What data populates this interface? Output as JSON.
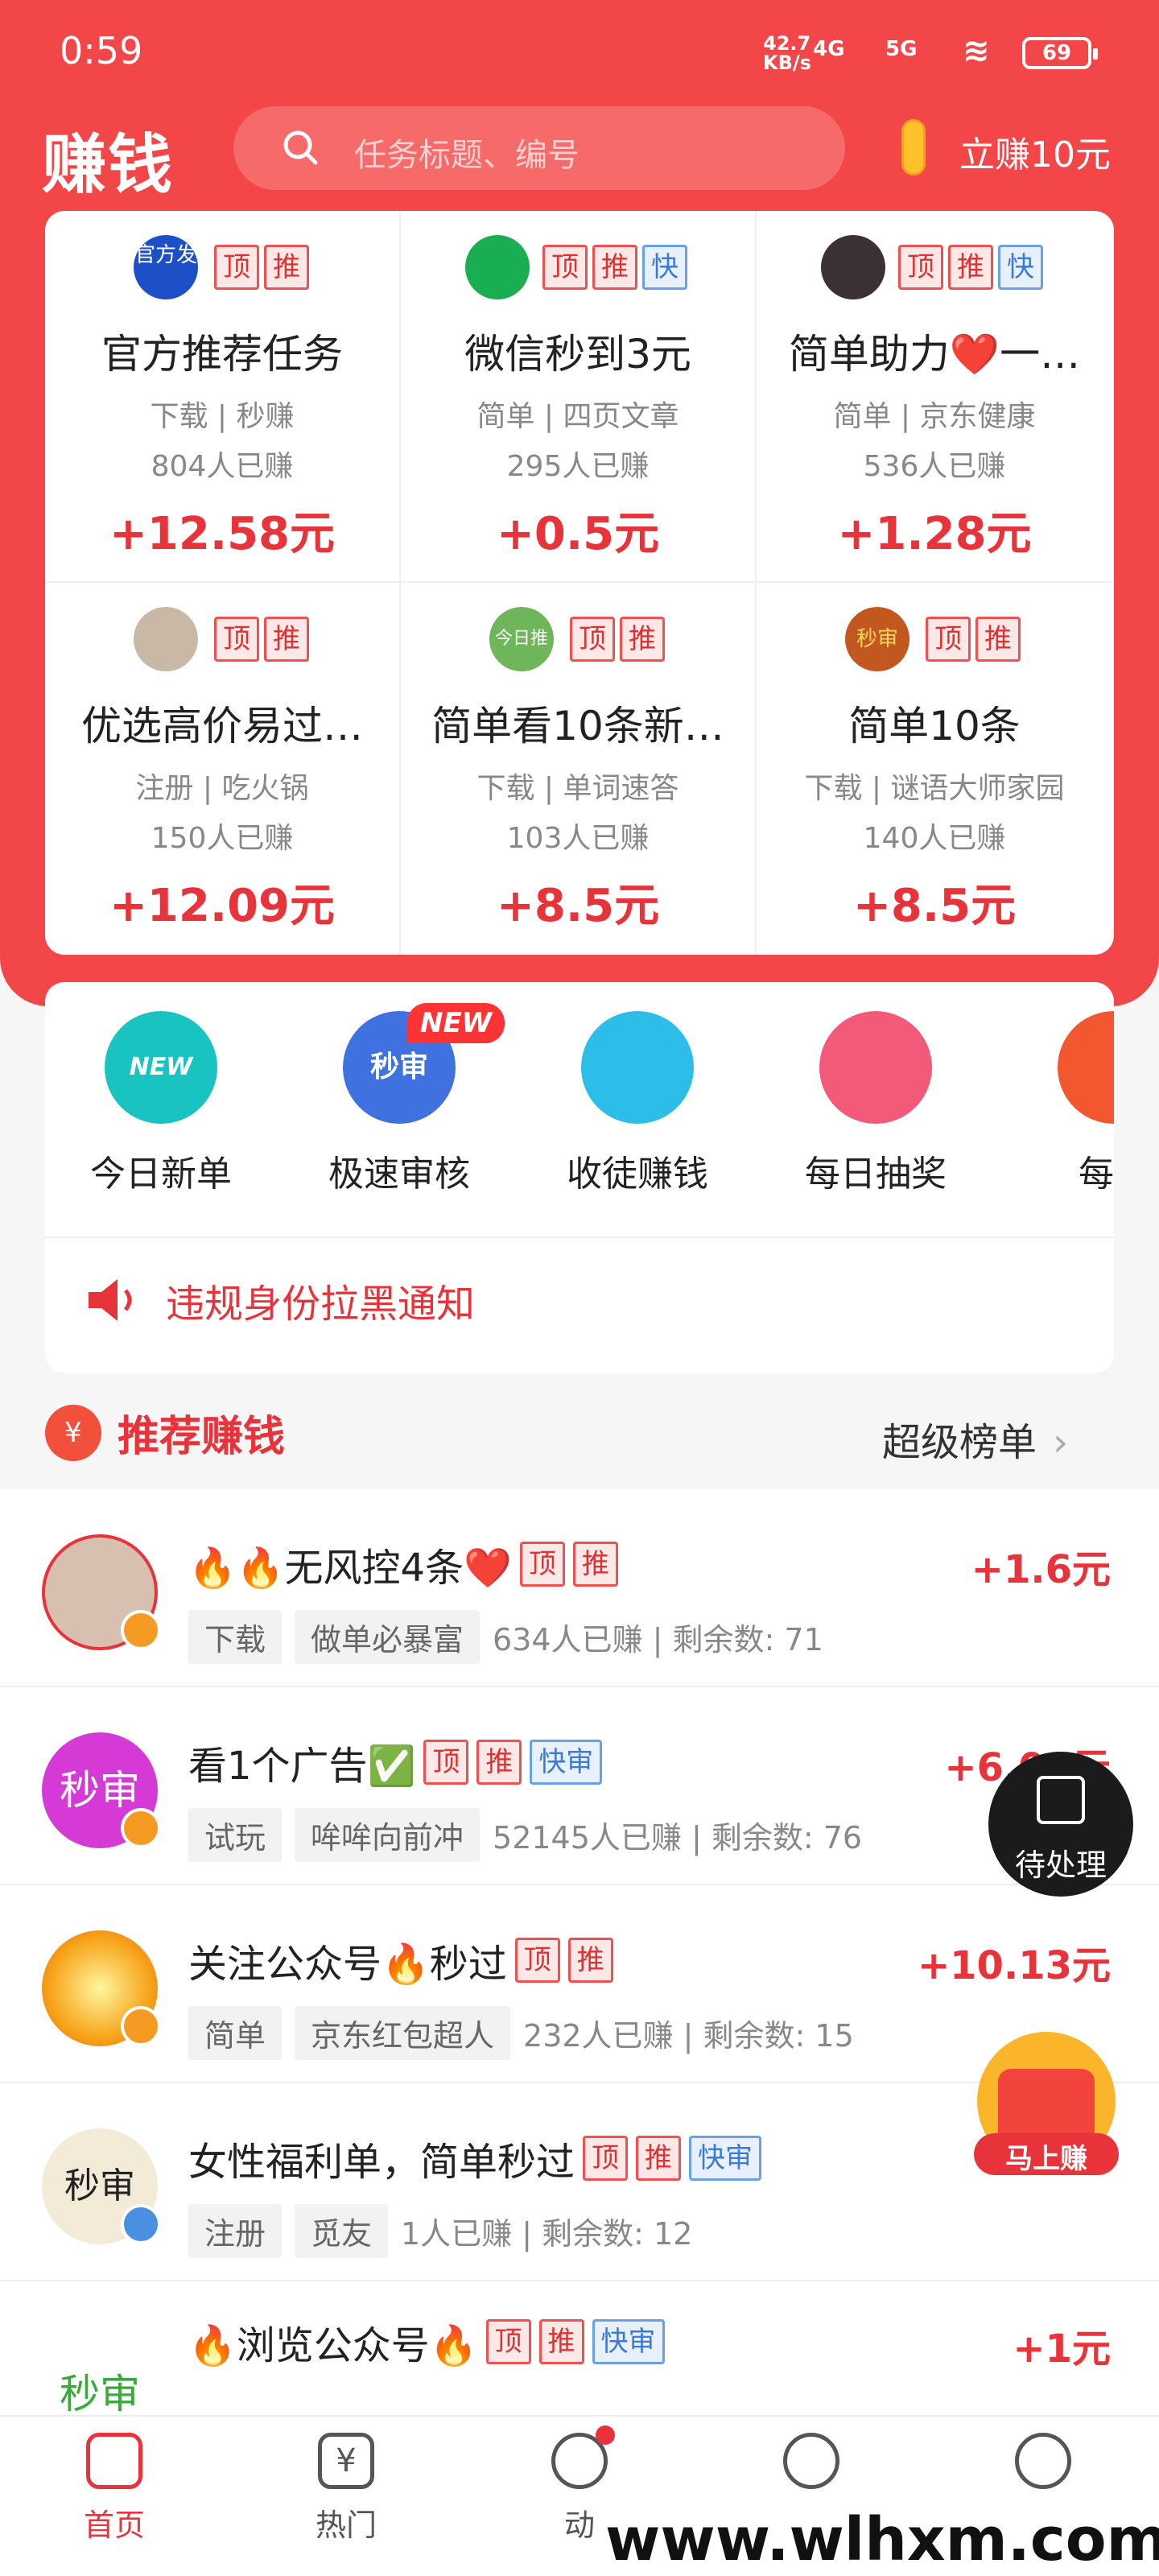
{
  "status": {
    "time": "0:59",
    "net_speed_top": "42.7",
    "net_speed_bottom": "KB/s",
    "net1": "4G",
    "net2": "5G",
    "battery": "69"
  },
  "header": {
    "logo": "赚钱",
    "search_placeholder": "任务标题、编号",
    "earn_text": "立赚10元"
  },
  "grid": [
    {
      "title": "官方推荐任务",
      "tags": [
        "顶",
        "推"
      ],
      "sub": "下载 | 秒赚",
      "count": "804人已赚",
      "price": "+12.58元",
      "avatar_text": "官方发"
    },
    {
      "title": "微信秒到3元",
      "tags": [
        "顶",
        "推",
        "快"
      ],
      "sub": "简单 | 四页文章",
      "count": "295人已赚",
      "price": "+0.5元"
    },
    {
      "title": "简单助力❤️一…",
      "tags": [
        "顶",
        "推",
        "快"
      ],
      "sub": "简单 | 京东健康",
      "count": "536人已赚",
      "price": "+1.28元"
    },
    {
      "title": "优选高价易过…",
      "tags": [
        "顶",
        "推"
      ],
      "sub": "注册 | 吃火锅",
      "count": "150人已赚",
      "price": "+12.09元"
    },
    {
      "title": "简单看10条新…",
      "tags": [
        "顶",
        "推"
      ],
      "sub": "下载 | 单词速答",
      "count": "103人已赚",
      "price": "+8.5元",
      "avatar_text": "今日推"
    },
    {
      "title": "简单10条",
      "tags": [
        "顶",
        "推"
      ],
      "sub": "下载 | 谜语大师家园",
      "count": "140人已赚",
      "price": "+8.5元",
      "avatar_text": "秒审"
    }
  ],
  "quick": [
    {
      "label": "今日新单",
      "icon": "NEW"
    },
    {
      "label": "极速审核",
      "icon": "秒审",
      "badge": "NEW"
    },
    {
      "label": "收徒赚钱"
    },
    {
      "label": "每日抽奖"
    },
    {
      "label": "每日"
    }
  ],
  "notice": "违规身份拉黑通知",
  "recommend": {
    "title": "推荐赚钱",
    "rank": "超级榜单",
    "icon": "¥"
  },
  "list": [
    {
      "name": "🔥🔥无风控4条❤️",
      "tags": [
        "顶",
        "推"
      ],
      "chips": [
        "下载",
        "做单必暴富"
      ],
      "stats": "634人已赚 | 剩余数: 71",
      "amount": "+1.6元"
    },
    {
      "name": "看1个广告✅",
      "tags": [
        "顶",
        "推",
        "快审"
      ],
      "chips": [
        "试玩",
        "哞哞向前冲"
      ],
      "stats": "52145人已赚 | 剩余数: 76",
      "amount": "+6.09元",
      "avatar_text": "秒审"
    },
    {
      "name": "关注公众号🔥秒过",
      "tags": [
        "顶",
        "推"
      ],
      "chips": [
        "简单",
        "京东红包超人"
      ],
      "stats": "232人已赚 | 剩余数: 15",
      "amount": "+10.13元"
    },
    {
      "name": "女性福利单，简单秒过",
      "tags": [
        "顶",
        "推",
        "快审"
      ],
      "chips": [
        "注册",
        "觅友"
      ],
      "stats": "1人已赚 | 剩余数: 12",
      "amount": "+",
      "avatar_text": "秒审"
    },
    {
      "name": "🔥浏览公众号🔥",
      "tags": [
        "顶",
        "推",
        "快审"
      ],
      "chips": [],
      "stats": "",
      "amount": "+1元",
      "avatar_text": "秒审"
    }
  ],
  "floating": {
    "pending": "待处理",
    "redpack": "马上赚"
  },
  "nav": [
    {
      "label": "首页",
      "active": true
    },
    {
      "label": "热门"
    },
    {
      "label": "动"
    },
    {
      "label": ""
    },
    {
      "label": ""
    }
  ],
  "watermark": "www.wlhxm.com",
  "colors": {
    "primary": "#f34648",
    "price": "#e8333a"
  }
}
